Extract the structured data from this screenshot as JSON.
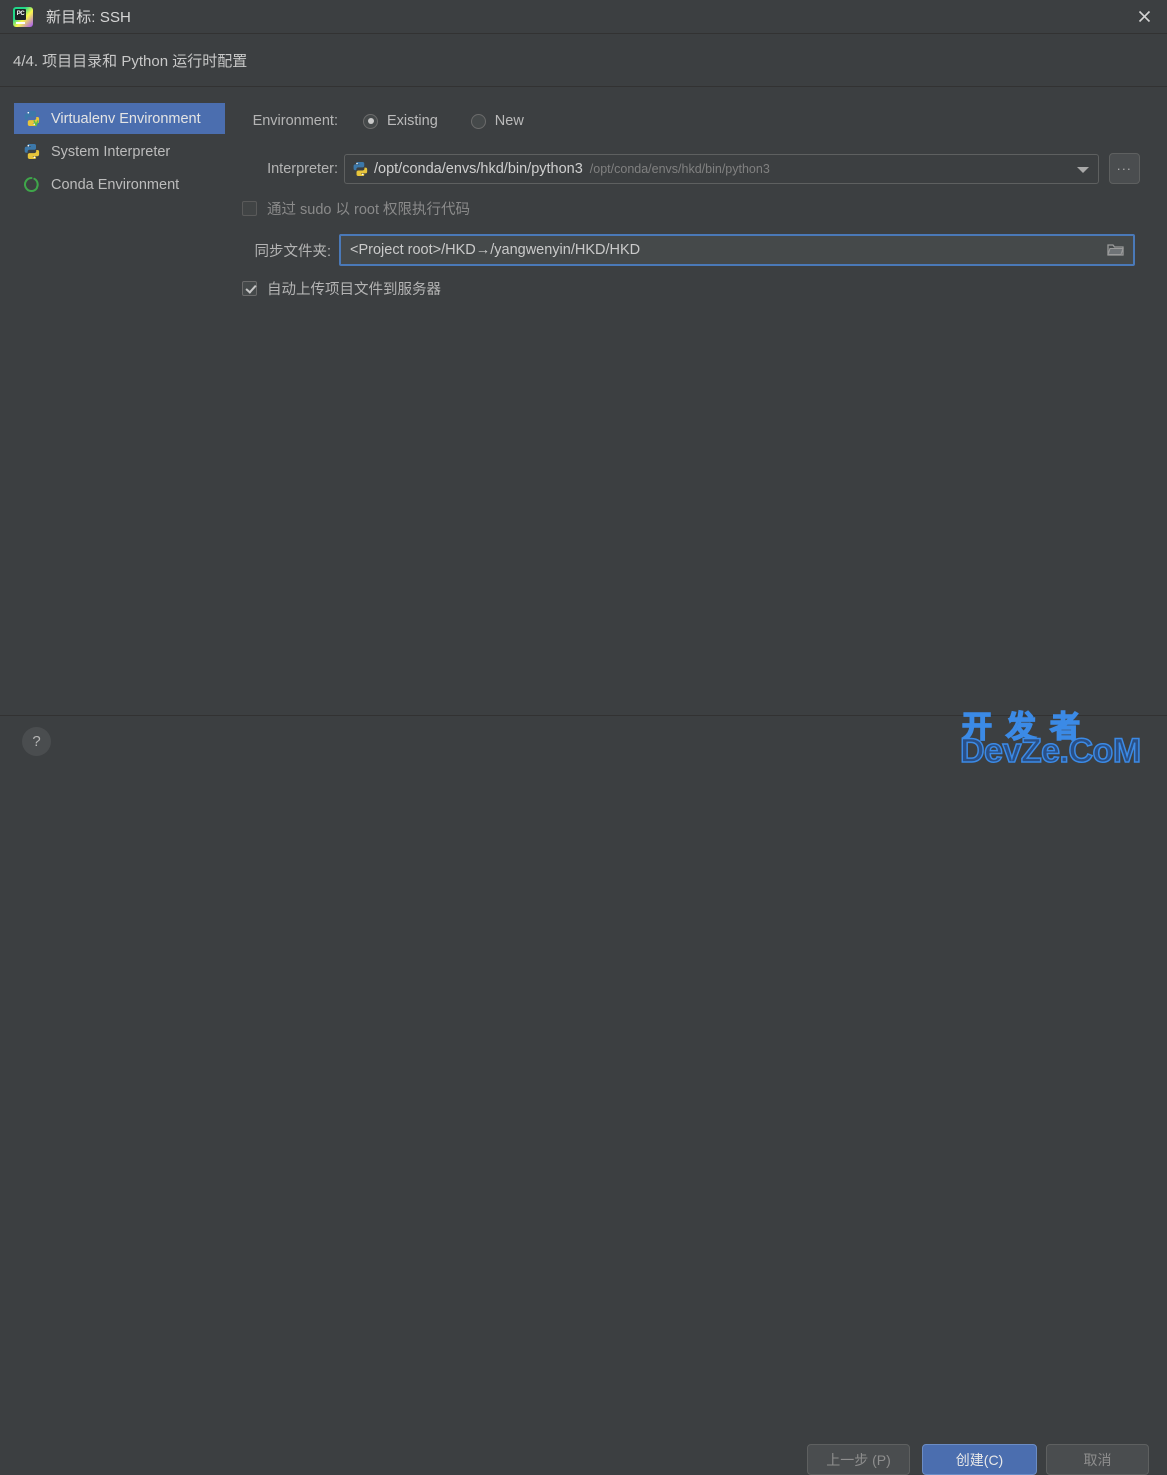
{
  "window": {
    "title": "新目标: SSH",
    "app_icon": "pycharm-icon",
    "close_label": "×"
  },
  "step": {
    "title": "4/4. 项目目录和 Python 运行时配置"
  },
  "sidebar": {
    "items": [
      {
        "label": "Virtualenv Environment",
        "icon": "virtualenv-python-icon",
        "selected": true
      },
      {
        "label": "System Interpreter",
        "icon": "python-icon",
        "selected": false
      },
      {
        "label": "Conda Environment",
        "icon": "conda-icon",
        "selected": false
      }
    ]
  },
  "form": {
    "environment": {
      "label": "Environment:",
      "options": [
        {
          "label": "Existing",
          "selected": true
        },
        {
          "label": "New",
          "selected": false
        }
      ]
    },
    "interpreter": {
      "label": "Interpreter:",
      "icon": "python-icon",
      "value": "/opt/conda/envs/hkd/bin/python3",
      "secondary_value": "/opt/conda/envs/hkd/bin/python3",
      "dropdown_icon": "chevron-down-icon",
      "browse_label": "...",
      "browse_icon": "ellipsis-icon"
    },
    "sudo_checkbox": {
      "label": "通过 sudo 以 root 权限执行代码",
      "checked": false,
      "disabled": true
    },
    "sync_folder": {
      "label": "同步文件夹:",
      "value": "<Project root>/HKD→/yangwenyin/HKD/HKD",
      "browse_icon": "folder-icon",
      "focused": true
    },
    "auto_upload_checkbox": {
      "label": "自动上传项目文件到服务器",
      "checked": true
    }
  },
  "footer": {
    "help_label": "?",
    "help_icon": "question-mark-icon",
    "back_label": "上一步 (P)",
    "create_label": "创建(C)",
    "cancel_label": "取消"
  },
  "watermark": {
    "line1": "开发者",
    "line2": "DevZe.CoM",
    "color": "#3b8ae6"
  },
  "colors": {
    "background": "#3c3f41",
    "selection": "#4b6eaf",
    "focus_border": "#4a79b8",
    "text": "#bbbbbb"
  }
}
